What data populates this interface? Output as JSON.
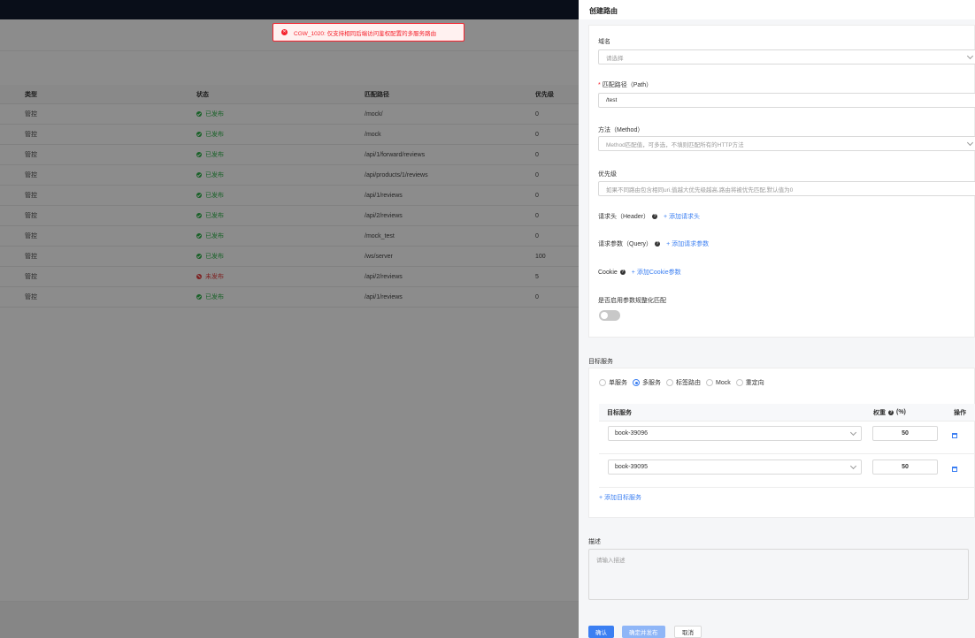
{
  "toast": {
    "message": "CGW_1020: 仅支持相同后端访问鉴权配置的多服务路由"
  },
  "table": {
    "headers": [
      "类型",
      "状态",
      "匹配路径",
      "优先级"
    ],
    "rows": [
      {
        "type": "管控",
        "status": "已发布",
        "path": "/mock/",
        "priority": "0",
        "published": true
      },
      {
        "type": "管控",
        "status": "已发布",
        "path": "/mock",
        "priority": "0",
        "published": true
      },
      {
        "type": "管控",
        "status": "已发布",
        "path": "/api/1/forward/reviews",
        "priority": "0",
        "published": true
      },
      {
        "type": "管控",
        "status": "已发布",
        "path": "/api/products/1/reviews",
        "priority": "0",
        "published": true
      },
      {
        "type": "管控",
        "status": "已发布",
        "path": "/api/1/reviews",
        "priority": "0",
        "published": true
      },
      {
        "type": "管控",
        "status": "已发布",
        "path": "/api/2/reviews",
        "priority": "0",
        "published": true
      },
      {
        "type": "管控",
        "status": "已发布",
        "path": "/mock_test",
        "priority": "0",
        "published": true
      },
      {
        "type": "管控",
        "status": "已发布",
        "path": "/ws/server",
        "priority": "100",
        "published": true
      },
      {
        "type": "管控",
        "status": "未发布",
        "path": "/api/2/reviews",
        "priority": "5",
        "published": false
      },
      {
        "type": "管控",
        "status": "已发布",
        "path": "/api/1/reviews",
        "priority": "0",
        "published": true
      }
    ]
  },
  "drawer": {
    "title": "创建路由",
    "domain": {
      "label": "域名",
      "placeholder": "请选择"
    },
    "path": {
      "required": "*",
      "label": "匹配路径（Path）",
      "value": "/test"
    },
    "method": {
      "label": "方法（Method）",
      "placeholder": "Method匹配值，可多选，不填则匹配所有的HTTP方法"
    },
    "priority": {
      "label": "优先级",
      "placeholder": "如果不同路由包含相同uri,值越大优先级越高,路由将被优先匹配,默认值为0"
    },
    "header": {
      "label": "请求头（Header）",
      "add": "+ 添加请求头"
    },
    "query": {
      "label": "请求参数（Query）",
      "add": "+ 添加请求参数"
    },
    "cookie": {
      "label": "Cookie",
      "add": "+ 添加Cookie参数"
    },
    "normalize": {
      "label": "是否启用参数规整化匹配"
    },
    "target": {
      "section_label": "目标服务",
      "radios": [
        "单服务",
        "多服务",
        "标签路由",
        "Mock",
        "重定向"
      ],
      "selected": "多服务",
      "col_service": "目标服务",
      "col_weight": "权重",
      "col_weight_unit": "(%)",
      "col_action": "操作",
      "services": [
        {
          "name": "book-39096",
          "weight": "50"
        },
        {
          "name": "book-39095",
          "weight": "50"
        }
      ],
      "add": "+ 添加目标服务"
    },
    "description": {
      "label": "描述",
      "placeholder": "请输入描述"
    },
    "buttons": {
      "confirm": "确认",
      "confirm_publish": "确定并发布",
      "cancel": "取消"
    }
  },
  "colors": {
    "accent": "#3b7ff2",
    "success": "#2eb34a",
    "error": "#f5222d"
  }
}
